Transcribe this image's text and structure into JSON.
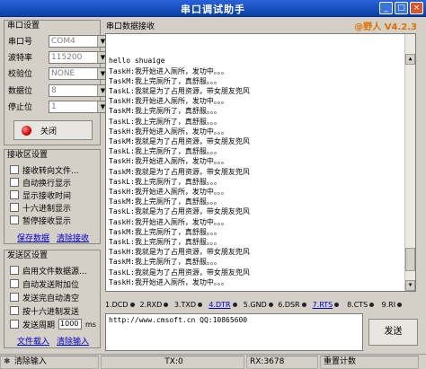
{
  "window": {
    "title": "串口调试助手",
    "brand": "@野人 V4.2.3"
  },
  "serial_settings": {
    "group_title": "串口设置",
    "fields": [
      {
        "label": "串口号",
        "value": "COM4"
      },
      {
        "label": "波特率",
        "value": "115200"
      },
      {
        "label": "校验位",
        "value": "NONE"
      },
      {
        "label": "数据位",
        "value": "8"
      },
      {
        "label": "停止位",
        "value": "1"
      }
    ],
    "close_label": "关闭"
  },
  "rx_settings": {
    "group_title": "接收区设置",
    "options": [
      "接收转向文件...",
      "自动换行显示",
      "显示接收时间",
      "十六进制显示",
      "暂停接收显示"
    ],
    "save_link": "保存数据",
    "clear_link": "清除接收"
  },
  "tx_settings": {
    "group_title": "发送区设置",
    "options": [
      "启用文件数据源...",
      "自动发送附加位",
      "发送完自动清空",
      "按十六进制发送"
    ],
    "period_label": "发送周期",
    "period_value": "1000",
    "period_unit": "ms",
    "load_link": "文件载入",
    "clear_link": "清除输入"
  },
  "receive": {
    "title": "串口数据接收",
    "lines": [
      "hello shuaige",
      "TaskH:我开始进入厕所，发功中。。。",
      "TaskM:我上完厕所了，真舒服。。。",
      "TaskL:我就是为了占用资源，带女朋友兜风",
      "TaskH:我开始进入厕所，发功中。。。",
      "TaskM:我上完厕所了，真舒服。。。",
      "TaskL:我上完厕所了，真舒服。。。",
      "TaskH:我开始进入厕所，发功中。。。",
      "TaskM:我就是为了占用资源，带女朋友兜风",
      "TaskL:我上完厕所了，真舒服。。。",
      "TaskH:我开始进入厕所，发功中。。。",
      "TaskM:我就是为了占用资源，带女朋友兜风",
      "TaskL:我上完厕所了，真舒服。。。",
      "TaskH:我开始进入厕所，发功中。。。",
      "TaskM:我上完厕所了，真舒服。。。",
      "TaskL:我就是为了占用资源，带女朋友兜风",
      "TaskH:我开始进入厕所，发功中。。。",
      "TaskM:我上完厕所了，真舒服。。。",
      "TaskL:我上完厕所了，真舒服。。。",
      "TaskH:我就是为了占用资源，带女朋友兜风",
      "TaskM:我上完厕所了，真舒服。。。",
      "TaskL:我就是为了占用资源，带女朋友兜风",
      "TaskH:我开始进入厕所，发功中。。。"
    ]
  },
  "pins": [
    {
      "label": "1.DCD",
      "highlight": false
    },
    {
      "label": "2.RXD",
      "highlight": false
    },
    {
      "label": "3.TXD",
      "highlight": false
    },
    {
      "label": "4.DTR",
      "highlight": true
    },
    {
      "label": "5.GND",
      "highlight": false
    },
    {
      "label": "6.DSR",
      "highlight": false
    },
    {
      "label": "7.RTS",
      "highlight": true
    },
    {
      "label": "8.CTS",
      "highlight": false
    },
    {
      "label": "9.RI",
      "highlight": false
    }
  ],
  "send": {
    "text": "http://www.cmsoft.cn QQ:10865600",
    "button": "发送"
  },
  "status": {
    "clear_label": "清除输入",
    "tx": "TX:0",
    "rx": "RX:3678",
    "reset": "重置计数"
  },
  "colors": {
    "titlebar": "#0a3ea8",
    "brand": "#e07000",
    "led": "#d40000",
    "link": "#0000d0"
  }
}
